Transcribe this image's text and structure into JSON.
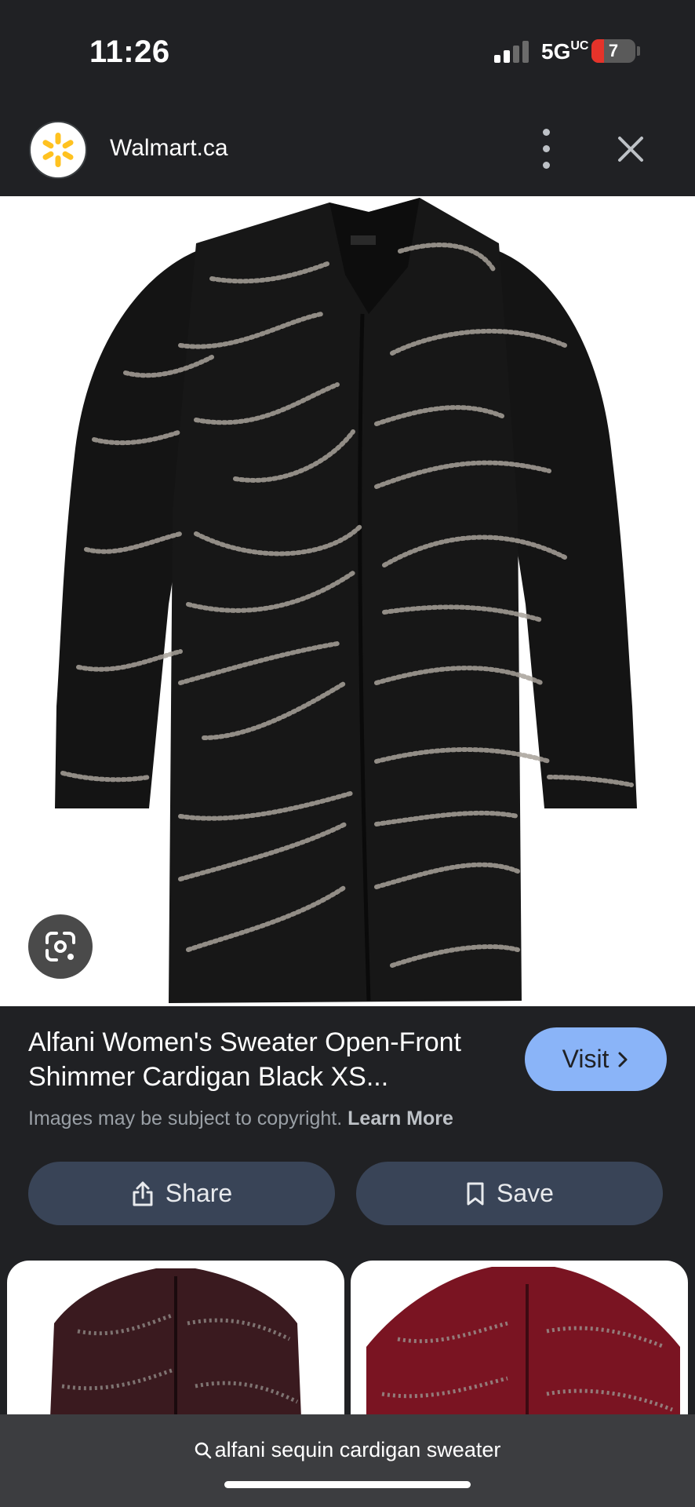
{
  "status_bar": {
    "time": "11:26",
    "network": "5G",
    "network_suffix": "UC",
    "battery_level": "7"
  },
  "header": {
    "site_name": "Walmart.ca",
    "logo_color": "#ffc220"
  },
  "product": {
    "title": "Alfani Women's Sweater Open-Front Shimmer Cardigan Black XS...",
    "visit_label": "Visit",
    "copyright_text": "Images may be subject to copyright.",
    "learn_more": "Learn More",
    "image_colors": {
      "garment": "#151515",
      "shimmer": "#a8a29a"
    }
  },
  "actions": {
    "share_label": "Share",
    "save_label": "Save"
  },
  "related": {
    "cards": [
      {
        "color": "#3a1a1f"
      },
      {
        "color": "#7a1422"
      }
    ]
  },
  "search": {
    "query": "alfani sequin cardigan sweater"
  }
}
